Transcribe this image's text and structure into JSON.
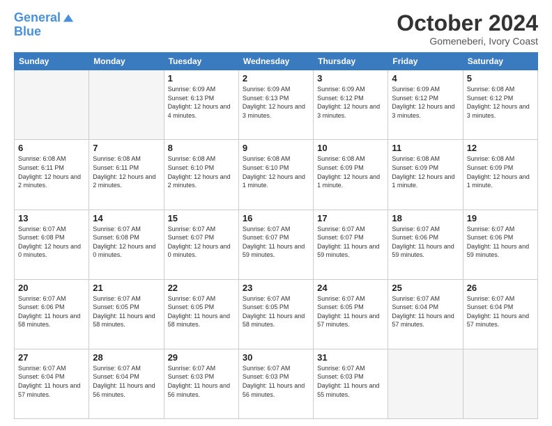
{
  "header": {
    "logo_line1": "General",
    "logo_line2": "Blue",
    "month": "October 2024",
    "location": "Gomeneberi, Ivory Coast"
  },
  "weekdays": [
    "Sunday",
    "Monday",
    "Tuesday",
    "Wednesday",
    "Thursday",
    "Friday",
    "Saturday"
  ],
  "weeks": [
    [
      {
        "day": "",
        "info": ""
      },
      {
        "day": "",
        "info": ""
      },
      {
        "day": "1",
        "info": "Sunrise: 6:09 AM\nSunset: 6:13 PM\nDaylight: 12 hours and 4 minutes."
      },
      {
        "day": "2",
        "info": "Sunrise: 6:09 AM\nSunset: 6:13 PM\nDaylight: 12 hours and 3 minutes."
      },
      {
        "day": "3",
        "info": "Sunrise: 6:09 AM\nSunset: 6:12 PM\nDaylight: 12 hours and 3 minutes."
      },
      {
        "day": "4",
        "info": "Sunrise: 6:09 AM\nSunset: 6:12 PM\nDaylight: 12 hours and 3 minutes."
      },
      {
        "day": "5",
        "info": "Sunrise: 6:08 AM\nSunset: 6:12 PM\nDaylight: 12 hours and 3 minutes."
      }
    ],
    [
      {
        "day": "6",
        "info": "Sunrise: 6:08 AM\nSunset: 6:11 PM\nDaylight: 12 hours and 2 minutes."
      },
      {
        "day": "7",
        "info": "Sunrise: 6:08 AM\nSunset: 6:11 PM\nDaylight: 12 hours and 2 minutes."
      },
      {
        "day": "8",
        "info": "Sunrise: 6:08 AM\nSunset: 6:10 PM\nDaylight: 12 hours and 2 minutes."
      },
      {
        "day": "9",
        "info": "Sunrise: 6:08 AM\nSunset: 6:10 PM\nDaylight: 12 hours and 1 minute."
      },
      {
        "day": "10",
        "info": "Sunrise: 6:08 AM\nSunset: 6:09 PM\nDaylight: 12 hours and 1 minute."
      },
      {
        "day": "11",
        "info": "Sunrise: 6:08 AM\nSunset: 6:09 PM\nDaylight: 12 hours and 1 minute."
      },
      {
        "day": "12",
        "info": "Sunrise: 6:08 AM\nSunset: 6:09 PM\nDaylight: 12 hours and 1 minute."
      }
    ],
    [
      {
        "day": "13",
        "info": "Sunrise: 6:07 AM\nSunset: 6:08 PM\nDaylight: 12 hours and 0 minutes."
      },
      {
        "day": "14",
        "info": "Sunrise: 6:07 AM\nSunset: 6:08 PM\nDaylight: 12 hours and 0 minutes."
      },
      {
        "day": "15",
        "info": "Sunrise: 6:07 AM\nSunset: 6:07 PM\nDaylight: 12 hours and 0 minutes."
      },
      {
        "day": "16",
        "info": "Sunrise: 6:07 AM\nSunset: 6:07 PM\nDaylight: 11 hours and 59 minutes."
      },
      {
        "day": "17",
        "info": "Sunrise: 6:07 AM\nSunset: 6:07 PM\nDaylight: 11 hours and 59 minutes."
      },
      {
        "day": "18",
        "info": "Sunrise: 6:07 AM\nSunset: 6:06 PM\nDaylight: 11 hours and 59 minutes."
      },
      {
        "day": "19",
        "info": "Sunrise: 6:07 AM\nSunset: 6:06 PM\nDaylight: 11 hours and 59 minutes."
      }
    ],
    [
      {
        "day": "20",
        "info": "Sunrise: 6:07 AM\nSunset: 6:06 PM\nDaylight: 11 hours and 58 minutes."
      },
      {
        "day": "21",
        "info": "Sunrise: 6:07 AM\nSunset: 6:05 PM\nDaylight: 11 hours and 58 minutes."
      },
      {
        "day": "22",
        "info": "Sunrise: 6:07 AM\nSunset: 6:05 PM\nDaylight: 11 hours and 58 minutes."
      },
      {
        "day": "23",
        "info": "Sunrise: 6:07 AM\nSunset: 6:05 PM\nDaylight: 11 hours and 58 minutes."
      },
      {
        "day": "24",
        "info": "Sunrise: 6:07 AM\nSunset: 6:05 PM\nDaylight: 11 hours and 57 minutes."
      },
      {
        "day": "25",
        "info": "Sunrise: 6:07 AM\nSunset: 6:04 PM\nDaylight: 11 hours and 57 minutes."
      },
      {
        "day": "26",
        "info": "Sunrise: 6:07 AM\nSunset: 6:04 PM\nDaylight: 11 hours and 57 minutes."
      }
    ],
    [
      {
        "day": "27",
        "info": "Sunrise: 6:07 AM\nSunset: 6:04 PM\nDaylight: 11 hours and 57 minutes."
      },
      {
        "day": "28",
        "info": "Sunrise: 6:07 AM\nSunset: 6:04 PM\nDaylight: 11 hours and 56 minutes."
      },
      {
        "day": "29",
        "info": "Sunrise: 6:07 AM\nSunset: 6:03 PM\nDaylight: 11 hours and 56 minutes."
      },
      {
        "day": "30",
        "info": "Sunrise: 6:07 AM\nSunset: 6:03 PM\nDaylight: 11 hours and 56 minutes."
      },
      {
        "day": "31",
        "info": "Sunrise: 6:07 AM\nSunset: 6:03 PM\nDaylight: 11 hours and 55 minutes."
      },
      {
        "day": "",
        "info": ""
      },
      {
        "day": "",
        "info": ""
      }
    ]
  ]
}
